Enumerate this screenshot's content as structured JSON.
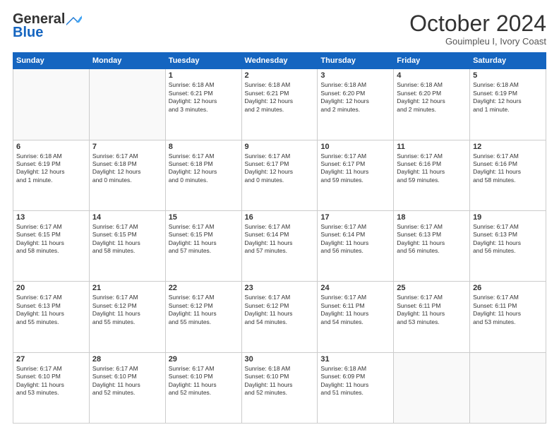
{
  "header": {
    "logo_line1": "General",
    "logo_line2": "Blue",
    "month": "October 2024",
    "location": "Gouimpleu I, Ivory Coast"
  },
  "days_of_week": [
    "Sunday",
    "Monday",
    "Tuesday",
    "Wednesday",
    "Thursday",
    "Friday",
    "Saturday"
  ],
  "weeks": [
    [
      {
        "day": "",
        "info": ""
      },
      {
        "day": "",
        "info": ""
      },
      {
        "day": "1",
        "info": "Sunrise: 6:18 AM\nSunset: 6:21 PM\nDaylight: 12 hours\nand 3 minutes."
      },
      {
        "day": "2",
        "info": "Sunrise: 6:18 AM\nSunset: 6:21 PM\nDaylight: 12 hours\nand 2 minutes."
      },
      {
        "day": "3",
        "info": "Sunrise: 6:18 AM\nSunset: 6:20 PM\nDaylight: 12 hours\nand 2 minutes."
      },
      {
        "day": "4",
        "info": "Sunrise: 6:18 AM\nSunset: 6:20 PM\nDaylight: 12 hours\nand 2 minutes."
      },
      {
        "day": "5",
        "info": "Sunrise: 6:18 AM\nSunset: 6:19 PM\nDaylight: 12 hours\nand 1 minute."
      }
    ],
    [
      {
        "day": "6",
        "info": "Sunrise: 6:18 AM\nSunset: 6:19 PM\nDaylight: 12 hours\nand 1 minute."
      },
      {
        "day": "7",
        "info": "Sunrise: 6:17 AM\nSunset: 6:18 PM\nDaylight: 12 hours\nand 0 minutes."
      },
      {
        "day": "8",
        "info": "Sunrise: 6:17 AM\nSunset: 6:18 PM\nDaylight: 12 hours\nand 0 minutes."
      },
      {
        "day": "9",
        "info": "Sunrise: 6:17 AM\nSunset: 6:17 PM\nDaylight: 12 hours\nand 0 minutes."
      },
      {
        "day": "10",
        "info": "Sunrise: 6:17 AM\nSunset: 6:17 PM\nDaylight: 11 hours\nand 59 minutes."
      },
      {
        "day": "11",
        "info": "Sunrise: 6:17 AM\nSunset: 6:16 PM\nDaylight: 11 hours\nand 59 minutes."
      },
      {
        "day": "12",
        "info": "Sunrise: 6:17 AM\nSunset: 6:16 PM\nDaylight: 11 hours\nand 58 minutes."
      }
    ],
    [
      {
        "day": "13",
        "info": "Sunrise: 6:17 AM\nSunset: 6:15 PM\nDaylight: 11 hours\nand 58 minutes."
      },
      {
        "day": "14",
        "info": "Sunrise: 6:17 AM\nSunset: 6:15 PM\nDaylight: 11 hours\nand 58 minutes."
      },
      {
        "day": "15",
        "info": "Sunrise: 6:17 AM\nSunset: 6:15 PM\nDaylight: 11 hours\nand 57 minutes."
      },
      {
        "day": "16",
        "info": "Sunrise: 6:17 AM\nSunset: 6:14 PM\nDaylight: 11 hours\nand 57 minutes."
      },
      {
        "day": "17",
        "info": "Sunrise: 6:17 AM\nSunset: 6:14 PM\nDaylight: 11 hours\nand 56 minutes."
      },
      {
        "day": "18",
        "info": "Sunrise: 6:17 AM\nSunset: 6:13 PM\nDaylight: 11 hours\nand 56 minutes."
      },
      {
        "day": "19",
        "info": "Sunrise: 6:17 AM\nSunset: 6:13 PM\nDaylight: 11 hours\nand 56 minutes."
      }
    ],
    [
      {
        "day": "20",
        "info": "Sunrise: 6:17 AM\nSunset: 6:13 PM\nDaylight: 11 hours\nand 55 minutes."
      },
      {
        "day": "21",
        "info": "Sunrise: 6:17 AM\nSunset: 6:12 PM\nDaylight: 11 hours\nand 55 minutes."
      },
      {
        "day": "22",
        "info": "Sunrise: 6:17 AM\nSunset: 6:12 PM\nDaylight: 11 hours\nand 55 minutes."
      },
      {
        "day": "23",
        "info": "Sunrise: 6:17 AM\nSunset: 6:12 PM\nDaylight: 11 hours\nand 54 minutes."
      },
      {
        "day": "24",
        "info": "Sunrise: 6:17 AM\nSunset: 6:11 PM\nDaylight: 11 hours\nand 54 minutes."
      },
      {
        "day": "25",
        "info": "Sunrise: 6:17 AM\nSunset: 6:11 PM\nDaylight: 11 hours\nand 53 minutes."
      },
      {
        "day": "26",
        "info": "Sunrise: 6:17 AM\nSunset: 6:11 PM\nDaylight: 11 hours\nand 53 minutes."
      }
    ],
    [
      {
        "day": "27",
        "info": "Sunrise: 6:17 AM\nSunset: 6:10 PM\nDaylight: 11 hours\nand 53 minutes."
      },
      {
        "day": "28",
        "info": "Sunrise: 6:17 AM\nSunset: 6:10 PM\nDaylight: 11 hours\nand 52 minutes."
      },
      {
        "day": "29",
        "info": "Sunrise: 6:17 AM\nSunset: 6:10 PM\nDaylight: 11 hours\nand 52 minutes."
      },
      {
        "day": "30",
        "info": "Sunrise: 6:18 AM\nSunset: 6:10 PM\nDaylight: 11 hours\nand 52 minutes."
      },
      {
        "day": "31",
        "info": "Sunrise: 6:18 AM\nSunset: 6:09 PM\nDaylight: 11 hours\nand 51 minutes."
      },
      {
        "day": "",
        "info": ""
      },
      {
        "day": "",
        "info": ""
      }
    ]
  ]
}
